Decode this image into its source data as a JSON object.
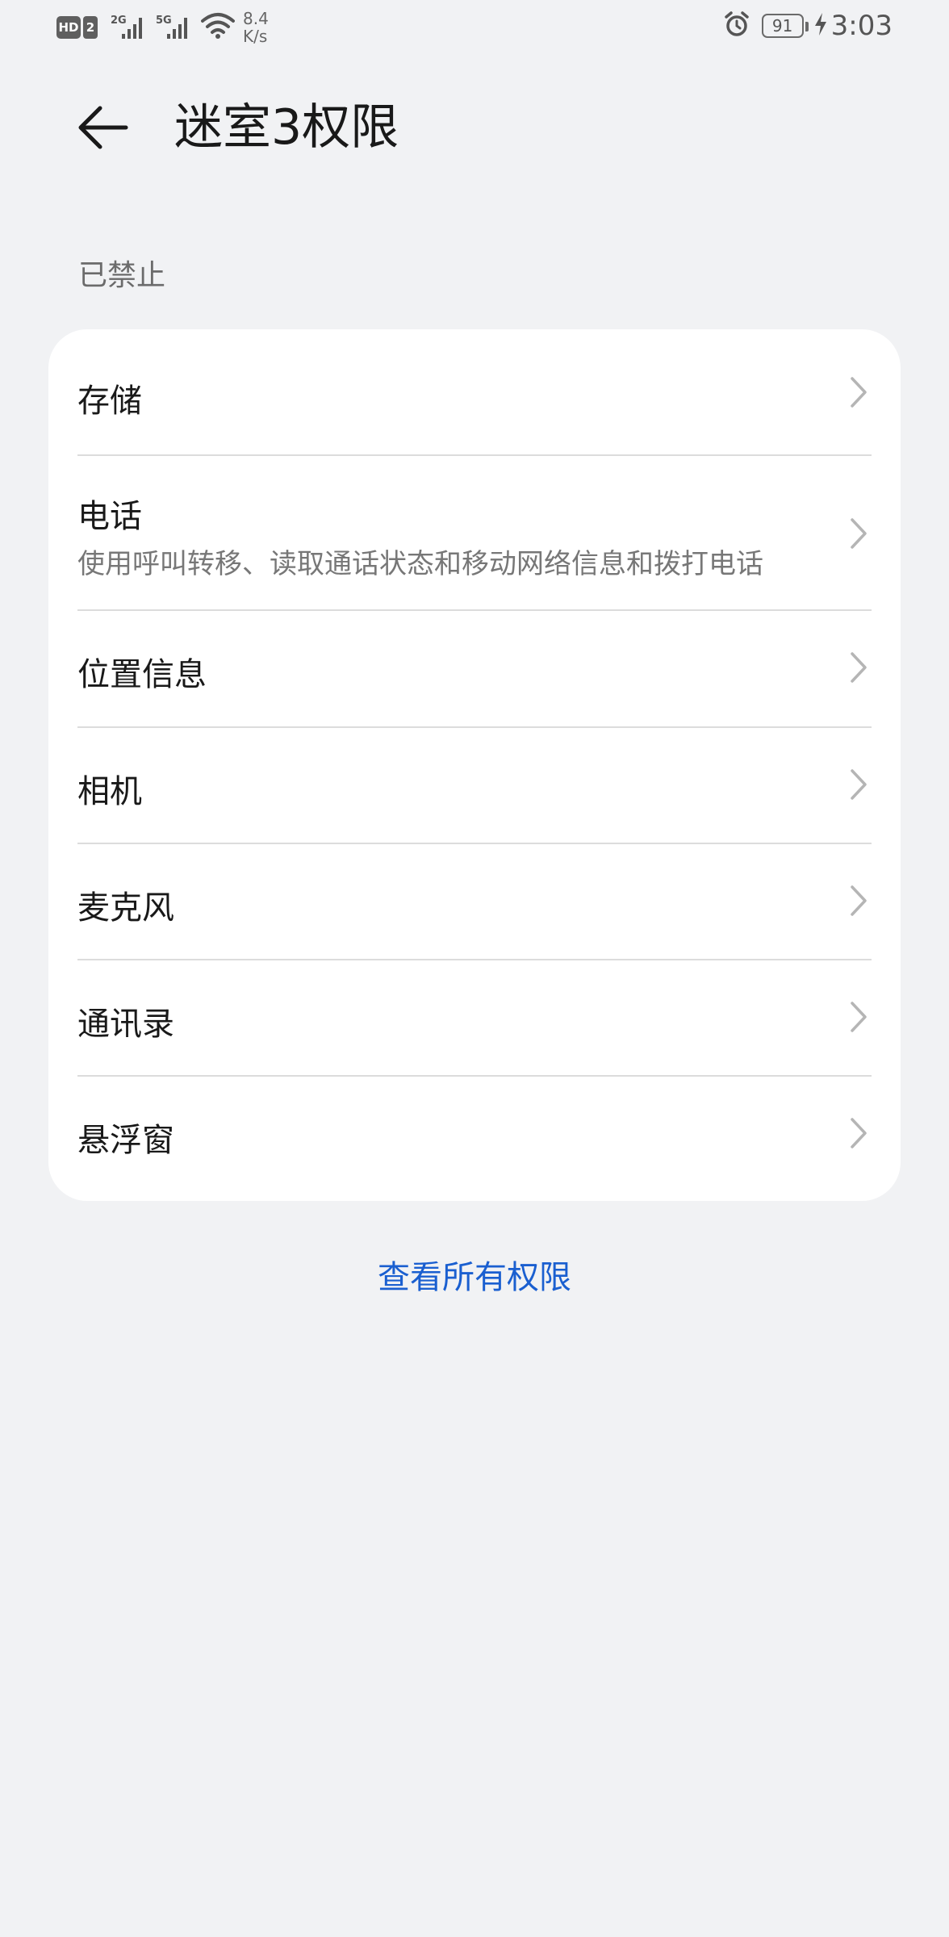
{
  "status_bar": {
    "hd_badge": "HD",
    "sim_badge": "2",
    "sim1_network": "2G",
    "sim2_network": "5G",
    "speed_value": "8.4",
    "speed_unit": "K/s",
    "battery": "91",
    "time": "3:03",
    "icons": [
      "signal-icon",
      "wifi-icon",
      "alarm-icon",
      "battery-icon",
      "charging-icon"
    ]
  },
  "header": {
    "title": "迷室3权限",
    "back_icon": "back-arrow-icon"
  },
  "section": {
    "label": "已禁止"
  },
  "permissions": [
    {
      "label": "存储",
      "subtitle": ""
    },
    {
      "label": "电话",
      "subtitle": "使用呼叫转移、读取通话状态和移动网络信息和拨打电话"
    },
    {
      "label": "位置信息",
      "subtitle": ""
    },
    {
      "label": "相机",
      "subtitle": ""
    },
    {
      "label": "麦克风",
      "subtitle": ""
    },
    {
      "label": "通讯录",
      "subtitle": ""
    },
    {
      "label": "悬浮窗",
      "subtitle": ""
    }
  ],
  "footer": {
    "view_all_label": "查看所有权限"
  },
  "colors": {
    "background": "#f1f2f4",
    "card": "#ffffff",
    "link": "#1a5fd0",
    "divider": "#dcdcdc"
  }
}
